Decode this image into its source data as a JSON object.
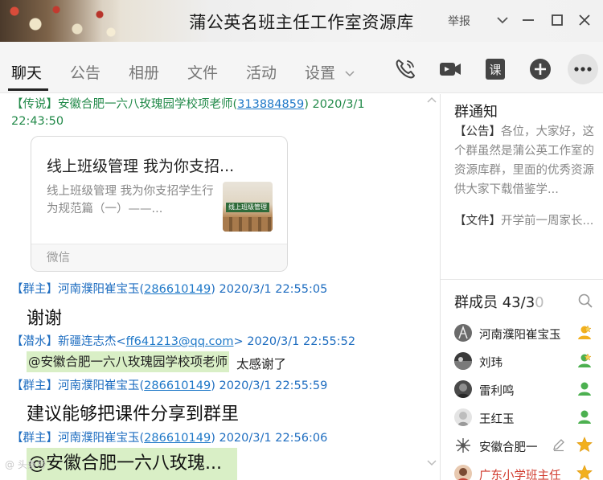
{
  "window": {
    "title": "蒲公英名班主任工作室资源库",
    "report_label": "举报"
  },
  "tabs": [
    {
      "label": "聊天"
    },
    {
      "label": "公告"
    },
    {
      "label": "相册"
    },
    {
      "label": "文件"
    },
    {
      "label": "活动"
    },
    {
      "label": "设置"
    }
  ],
  "toolbar_icons": [
    "phone-icon",
    "video-call-icon",
    "course-icon",
    "add-icon",
    "more-icon"
  ],
  "messages": [
    {
      "tag": "【传说】",
      "name": "安徽合肥一六八玫瑰园学校项老师(",
      "id": "313884859",
      "close": ")",
      "time_a": "2020/3/1",
      "time_b": "22:43:50",
      "card": {
        "title": "线上班级管理  我为你支招...",
        "desc": "线上班级管理  我为你支招学生行为规范篇（一）——...",
        "thumb_text": "线上班级管理",
        "source": "微信"
      }
    },
    {
      "tag": "【群主】",
      "name": "河南濮阳崔宝玉(",
      "id": "286610149",
      "close": ")",
      "time": "2020/3/1 22:55:05",
      "text": "谢谢"
    },
    {
      "tag": "【潜水】",
      "name": "新疆连志杰<",
      "id": "ff641213@qq.com",
      "close": ">",
      "time": "2020/3/1 22:55:52",
      "quote": "@安徽合肥一六八玫瑰园学校项老师",
      "text": "太感谢了"
    },
    {
      "tag": "【群主】",
      "name": "河南濮阳崔宝玉(",
      "id": "286610149",
      "close": ")",
      "time": "2020/3/1 22:55:59",
      "text": "建议能够把课件分享到群里"
    },
    {
      "tag": "【群主】",
      "name": "河南濮阳崔宝玉(",
      "id": "286610149",
      "close": ")",
      "time": "2020/3/1 22:56:06",
      "quote": "@安徽合肥一六八玫瑰..."
    }
  ],
  "watermark": "@ 头条号",
  "group_notice": {
    "title": "群通知",
    "announce_label": "【公告】",
    "announce_text": "各位，大家好，这个群虽然是蒲公英工作室的资源库群，里面的优秀资源供大家下载借鉴学...",
    "file_label": "【文件】",
    "file_text": "开学前一周家长..."
  },
  "members": {
    "title": "群成员 43/3",
    "title_dim": "0",
    "list": [
      {
        "name": "河南濮阳崔宝玉",
        "badge_color": "#f2b01e"
      },
      {
        "name": "刘玮",
        "badge_color": "#f2b01e"
      },
      {
        "name": "雷利鸣",
        "badge_color": "#4cb050"
      },
      {
        "name": "王红玉",
        "badge_color": "#4cb050"
      },
      {
        "name": "安徽合肥一",
        "badge_color": "#f2b01e"
      },
      {
        "name": "广东小学班主任",
        "badge_color": "#f2b01e"
      }
    ]
  }
}
